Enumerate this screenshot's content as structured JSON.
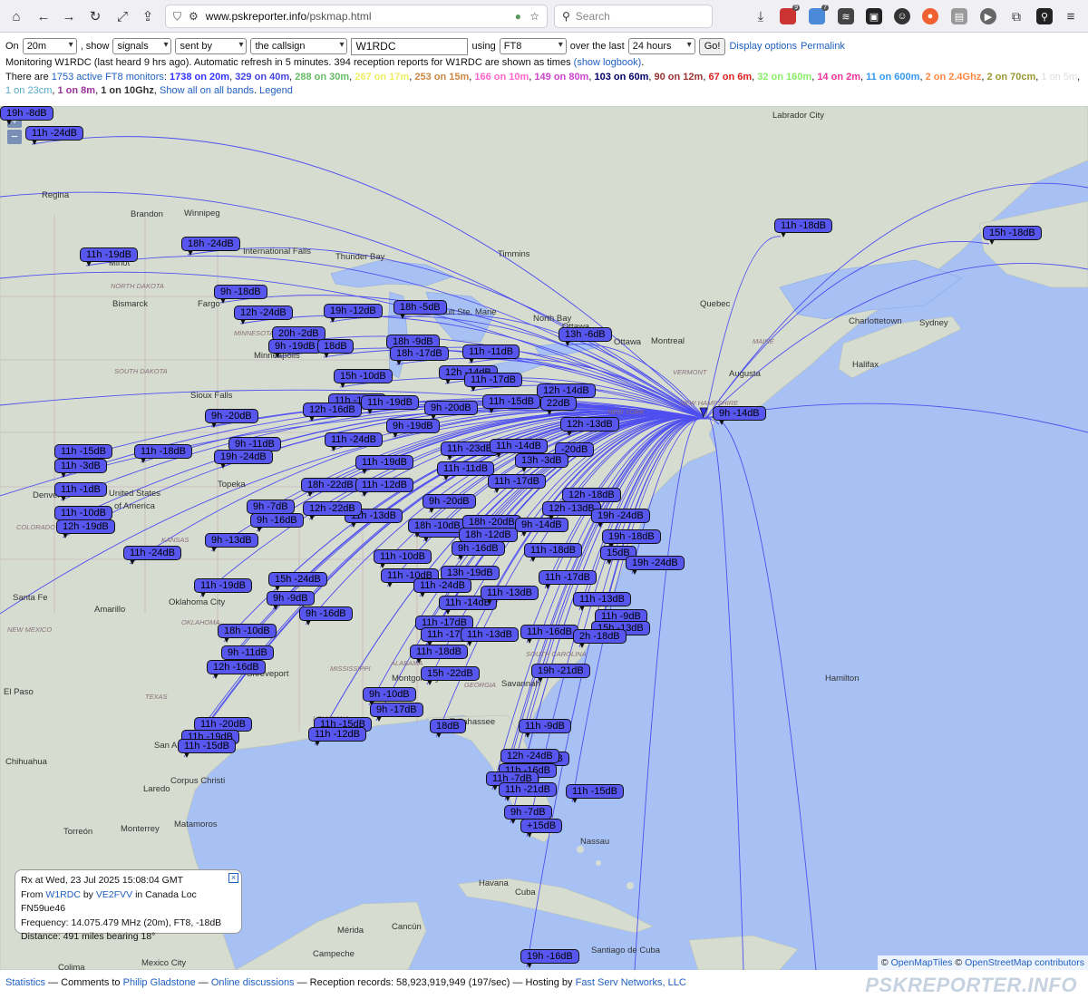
{
  "browser": {
    "url_host": "www.pskreporter.info",
    "url_path": "/pskmap.html",
    "search_placeholder": "Search",
    "badges": [
      "9",
      "7"
    ]
  },
  "controls": {
    "on_label": "On",
    "band": "20m",
    "show_label": ", show",
    "mode_show": "signals",
    "direction": "sent by",
    "target": "the callsign",
    "callsign": "W1RDC",
    "using_label": "using",
    "protocol": "FT8",
    "over_label": "over the last",
    "period": "24 hours",
    "go": "Go!",
    "display_options": "Display options",
    "permalink": "Permalink"
  },
  "status": {
    "text": "Monitoring W1RDC (last heard 9 hrs ago). Automatic refresh in 5 minutes. 394 reception reports for W1RDC are shown as times",
    "logbook_link": "(show logbook)",
    "suffix": "."
  },
  "monitors": {
    "prefix": "There are",
    "active_link": "1753 active FT8 monitors",
    "colon": ":",
    "bands": [
      {
        "text": "1738 on 20m",
        "color": "#3333ff",
        "bold": true
      },
      {
        "text": "329 on 40m",
        "color": "#4444dd",
        "bold": true
      },
      {
        "text": "288 on 30m",
        "color": "#66bb66",
        "bold": true
      },
      {
        "text": "267 on 17m",
        "color": "#eeee66",
        "bold": true
      },
      {
        "text": "253 on 15m",
        "color": "#cc8844",
        "bold": true
      },
      {
        "text": "166 on 10m",
        "color": "#ff66cc",
        "bold": true
      },
      {
        "text": "149 on 80m",
        "color": "#cc44cc",
        "bold": true
      },
      {
        "text": "103 on 60m",
        "color": "#000066",
        "bold": true
      },
      {
        "text": "90 on 12m",
        "color": "#993333",
        "bold": true
      },
      {
        "text": "67 on 6m",
        "color": "#dd2222",
        "bold": true
      },
      {
        "text": "32 on 160m",
        "color": "#88ee66",
        "bold": true
      },
      {
        "text": "14 on 2m",
        "color": "#ee3399",
        "bold": true
      },
      {
        "text": "11 on 600m",
        "color": "#3399ee",
        "bold": true
      },
      {
        "text": "2 on 2.4Ghz",
        "color": "#ff8844",
        "bold": true
      },
      {
        "text": "2 on 70cm",
        "color": "#999933",
        "bold": true
      },
      {
        "text": "1 on 5m",
        "color": "#dddddd",
        "bold": false
      },
      {
        "text": "1 on 23cm",
        "color": "#55aacc",
        "bold": false
      },
      {
        "text": "1 on 8m",
        "color": "#993399",
        "bold": true
      },
      {
        "text": "1 on 10Ghz",
        "color": "#333333",
        "bold": true
      }
    ],
    "show_all_link": "Show all on all bands",
    "legend_link": "Legend"
  },
  "map": {
    "zoom_in": "+",
    "zoom_out": "−",
    "places": [
      {
        "name": "Labrador City"
      },
      {
        "name": "Regina"
      },
      {
        "name": "Brandon"
      },
      {
        "name": "Winnipeg"
      },
      {
        "name": "International Falls"
      },
      {
        "name": "Thunder Bay"
      },
      {
        "name": "Timmins"
      },
      {
        "name": "Minot"
      },
      {
        "name": "Bismarck"
      },
      {
        "name": "Fargo"
      },
      {
        "name": "Quebec"
      },
      {
        "name": "Charlottetown"
      },
      {
        "name": "Sydney"
      },
      {
        "name": "North Bay"
      },
      {
        "name": "Ottawa"
      },
      {
        "name": "Montreal"
      },
      {
        "name": "Augusta"
      },
      {
        "name": "Halifax"
      },
      {
        "name": "Sioux Falls"
      },
      {
        "name": "Minneapolis"
      },
      {
        "name": "Sault Ste. Marie"
      },
      {
        "name": "United States"
      },
      {
        "name": "of America"
      },
      {
        "name": "Topeka"
      },
      {
        "name": "Denver"
      },
      {
        "name": "Santa Fe"
      },
      {
        "name": "Amarillo"
      },
      {
        "name": "Oklahoma City"
      },
      {
        "name": "Shreveport"
      },
      {
        "name": "El Paso"
      },
      {
        "name": "San Antonio"
      },
      {
        "name": "Chihuahua"
      },
      {
        "name": "Corpus Christi"
      },
      {
        "name": "Laredo"
      },
      {
        "name": "Torreón"
      },
      {
        "name": "Monterrey"
      },
      {
        "name": "Matamoros"
      },
      {
        "name": "Hamilton"
      },
      {
        "name": "Nassau"
      },
      {
        "name": "Havana"
      },
      {
        "name": "Cuba"
      },
      {
        "name": "Mérida"
      },
      {
        "name": "Cancún"
      },
      {
        "name": "Campeche"
      },
      {
        "name": "Santiago de Cuba"
      },
      {
        "name": "Mexico City"
      },
      {
        "name": "Colima"
      },
      {
        "name": "Savannah"
      },
      {
        "name": "Tallahassee"
      },
      {
        "name": "Miami"
      },
      {
        "name": "New Orleans"
      },
      {
        "name": "Montgomery"
      },
      {
        "name": "Ottawa"
      }
    ],
    "regions": [
      "NORTH DAKOTA",
      "SOUTH DAKOTA",
      "MINNESOTA",
      "KANSAS",
      "OKLAHOMA",
      "TEXAS",
      "NEW MEXICO",
      "COLORADO",
      "MISSISSIPPI",
      "ALABAMA",
      "GEORGIA",
      "LOUISIANA",
      "SOUTH CAROLINA",
      "VERMONT",
      "NEW HAMPSHIRE",
      "MAINE",
      "NEW YORK"
    ],
    "spots": [
      "11h -24dB",
      "18h -24dB",
      "11h -19dB",
      "9h -18dB",
      "12h -24dB",
      "19h -12dB",
      "18h -5dB",
      "20h -2dB",
      "9h -19dB",
      "18dB",
      "18h -9dB",
      "18h -17dB",
      "11h -11dB",
      "13h -6dB",
      "15h -10dB",
      "12h -14dB",
      "11h -17dB",
      "12h -14dB",
      "11h -19dB",
      "12h -16dB",
      "11h -15dB",
      "22dB",
      "9h -20dB",
      "9h -20dB",
      "11h -19dB",
      "9h -19dB",
      "12h -13dB",
      "9h -14dB",
      "11h -15dB",
      "11h -18dB",
      "11h -3dB",
      "9h -11dB",
      "19h -24dB",
      "11h -24dB",
      "11h -23dB",
      "11h -14dB",
      "-20dB",
      "11h -19dB",
      "11h -11dB",
      "13h -3dB",
      "11h -1dB",
      "18h -22dB",
      "11h -12dB",
      "11h -17dB",
      "12h -18dB",
      "11h -13dB",
      "9h -20dB",
      "11h -10dB",
      "12h -19dB",
      "9h -7dB",
      "12h -22dB",
      "9h -16dB",
      "11h -13dB",
      "18h -10dB",
      "18h -20dB",
      "9h -14dB",
      "12h -13dB",
      "19h -24dB",
      "18h -12dB",
      "19h -18dB",
      "9h -13dB",
      "11h -24dB",
      "9h -16dB",
      "11h -18dB",
      "15dB",
      "11h -10dB",
      "19h -24dB",
      "13h -19dB",
      "11h -10dB",
      "11h -17dB",
      "15h -24dB",
      "11h -19dB",
      "11h -24dB",
      "9h -9dB",
      "11h -14dB",
      "11h -13dB",
      "11h -13dB",
      "9h -16dB",
      "11h -17dB",
      "11h -9dB",
      "11h -17dB",
      "15h -13dB",
      "18h -10dB",
      "11h -13dB",
      "11h -16dB",
      "2h -18dB",
      "9h -11dB",
      "11h -18dB",
      "12h -16dB",
      "15h -22dB",
      "19h -21dB",
      "9h -10dB",
      "11h -15dB",
      "9h -17dB",
      "11h -20dB",
      "11h -12dB",
      "18dB",
      "11h -9dB",
      "11h -19dB",
      "11h -15dB",
      "11h -9dB",
      "12h -24dB",
      "11h -16dB",
      "11h -7dB",
      "11h -21dB",
      "11h -15dB",
      "9h -7dB",
      "+15dB",
      "11h -18dB",
      "15h -18dB",
      "19h -16dB",
      "19h -8dB"
    ],
    "popup": {
      "title": "Rx at Wed, 23 Jul 2025 15:08:04 GMT",
      "from_label": "From",
      "from_call": "W1RDC",
      "by_label": "by",
      "by_call": "VE2FVV",
      "loc_text": "in Canada Loc FN59ue46",
      "frequency": "Frequency: 14.075.479 MHz (20m), FT8, -18dB",
      "distance": "Distance: 491 miles bearing 18°"
    },
    "attribution": {
      "osm_tiles": "OpenMapTiles",
      "osm_contrib": "OpenStreetMap contributors",
      "copy": "©"
    },
    "colors": {
      "ocean": "#a7c1f4",
      "land": "#d6dcd0",
      "spot_fill": "#5757f0",
      "path": "#4f4ff0"
    }
  },
  "footer": {
    "statistics": "Statistics",
    "comments_prefix": "— Comments to",
    "author": "Philip Gladstone",
    "sep1": "—",
    "online": "Online discussions",
    "records": "— Reception records: 58,923,919,949 (197/sec) — Hosting by",
    "host": "Fast Serv Networks, LLC",
    "brand": "PSKREPORTER.INFO"
  }
}
